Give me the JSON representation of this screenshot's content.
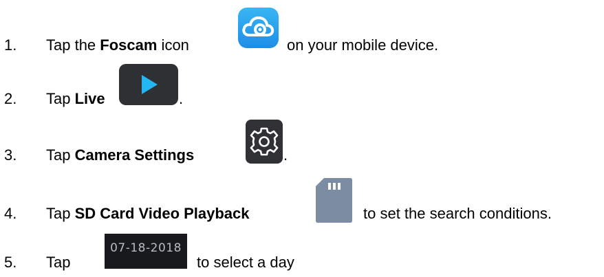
{
  "steps": [
    {
      "number": "1.",
      "prefix": "Tap the ",
      "bold": "Foscam",
      "middle": " icon",
      "suffix": "on your mobile device."
    },
    {
      "number": "2.",
      "prefix": "Tap ",
      "bold": "Live",
      "suffix": "."
    },
    {
      "number": "3.",
      "prefix": "Tap ",
      "bold": "Camera Settings",
      "suffix": "."
    },
    {
      "number": "4.",
      "prefix": "Tap ",
      "bold": "SD Card Video Playback",
      "suffix": "to set the search conditions."
    },
    {
      "number": "5.",
      "prefix": "Tap",
      "date_button": "07-18-2018",
      "suffix": "to select a day"
    }
  ],
  "icons": {
    "foscam": "cloud-camera-icon",
    "live": "play-icon",
    "settings": "gear-icon",
    "sdcard": "sd-card-icon"
  },
  "colors": {
    "foscam_top": "#38b6f4",
    "foscam_bottom": "#1d8de6",
    "play_triangle": "#23b6f0",
    "dark_tile": "#2f3034",
    "sd_card": "#7b8ca3",
    "date_bg": "#17191c",
    "date_text": "#b8bcc2"
  }
}
